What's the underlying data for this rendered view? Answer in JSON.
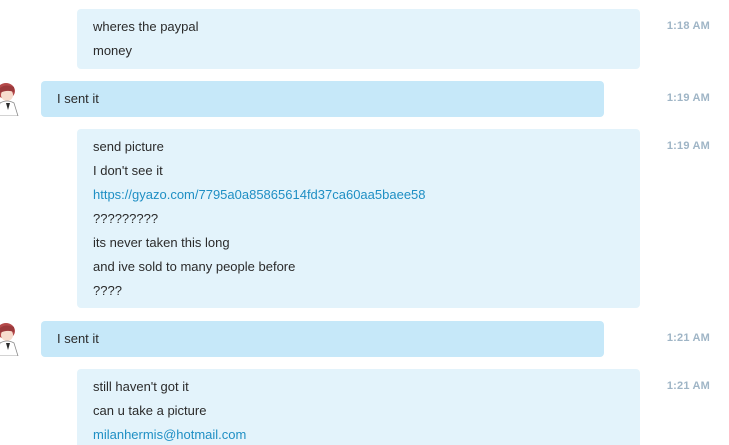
{
  "messages": [
    {
      "sender": "other",
      "time": "1:18 AM",
      "lines": [
        "wheres the paypal",
        "money"
      ]
    },
    {
      "sender": "me",
      "time": "1:19 AM",
      "lines": [
        "I sent it"
      ]
    },
    {
      "sender": "other",
      "time": "1:19 AM",
      "lines": [
        "send picture",
        "I don't see it",
        "https://gyazo.com/7795a0a85865614fd37ca60aa5baee58",
        "?????????",
        "its never taken this long",
        "and ive sold to many people before",
        "????"
      ]
    },
    {
      "sender": "me",
      "time": "1:21 AM",
      "lines": [
        "I sent it"
      ]
    },
    {
      "sender": "other",
      "time": "1:21 AM",
      "lines": [
        "still haven't got it",
        "can u take a picture",
        "milanhermis@hotmail.com"
      ]
    }
  ],
  "colors": {
    "incoming_bubble": "#e3f3fb",
    "outgoing_bubble": "#c6e8f9",
    "link": "#1f8fc4",
    "timestamp": "#9fb5c6"
  }
}
